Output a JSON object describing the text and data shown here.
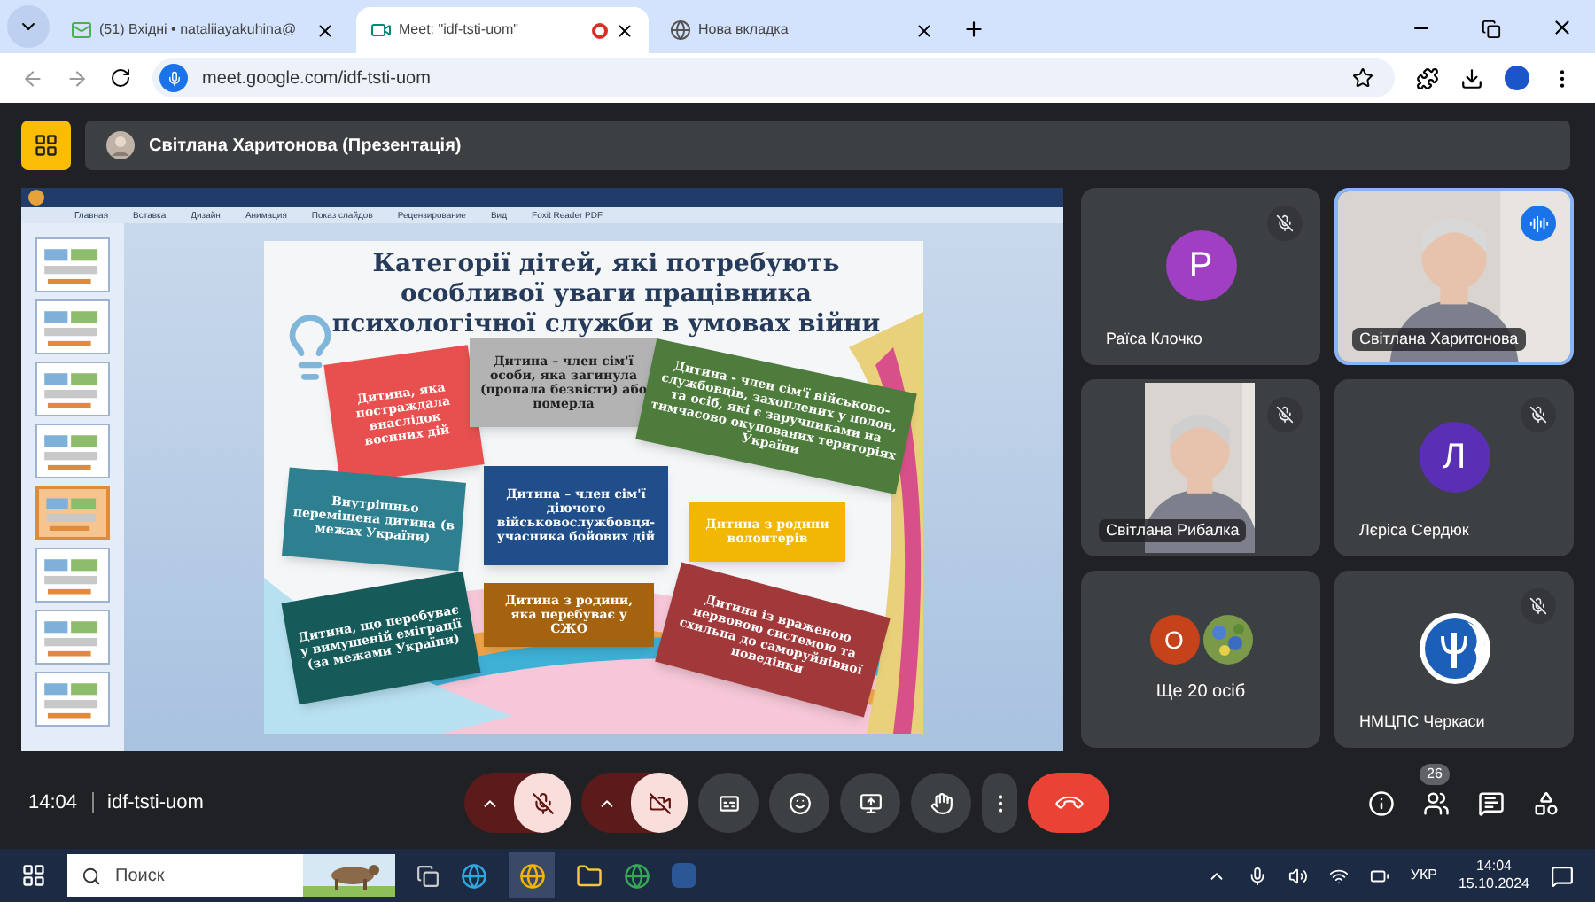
{
  "browser": {
    "tabs": [
      {
        "label": "(51) Вхідні • nataliiayakuhina@",
        "kind": "mail",
        "selected": false
      },
      {
        "label": "Meet: \"idf-tsti-uom\"",
        "kind": "meet",
        "selected": true,
        "recording": true
      },
      {
        "label": "Нова вкладка",
        "kind": "chrome",
        "selected": false
      }
    ],
    "address": "meet.google.com/idf-tsti-uom"
  },
  "meet": {
    "presenter": "Світлана Харитонова (Презентація)",
    "presentation": {
      "ribbon_tabs": [
        "Главная",
        "Вставка",
        "Дизайн",
        "Анимация",
        "Показ слайдов",
        "Рецензирование",
        "Вид",
        "Foxit Reader PDF"
      ],
      "thumbnails": [
        {
          "selected": false
        },
        {
          "selected": false
        },
        {
          "selected": false
        },
        {
          "selected": false
        },
        {
          "selected": true
        },
        {
          "selected": false
        },
        {
          "selected": false
        },
        {
          "selected": false
        }
      ],
      "slide": {
        "title": "Категорії дітей, які потребують особливої уваги працівника психологічної служби в умовах війни",
        "cards": [
          {
            "text": "Дитина, яка постраждала внаслідок воєнних дій",
            "color": "#e8504f"
          },
          {
            "text": "Дитина – член сім'ї особи, яка загинула (пропала безвісти) або померла",
            "color": "#b3b3b3"
          },
          {
            "text": "Дитина - член сім'ї військово-службовців, захоплених у полон, та осіб, які є заручниками на тимчасово окупованих територіях України",
            "color": "#4e7c3c"
          },
          {
            "text": "Внутрішньо переміщена дитина (в межах України)",
            "color": "#2e7f8f"
          },
          {
            "text": "Дитина – член сім'ї діючого військовослужбовця-учасника бойових дій",
            "color": "#1f4e8a"
          },
          {
            "text": "Дитина з родини волонтерів",
            "color": "#f2b705"
          },
          {
            "text": "Дитина, що перебуває у вимушеній еміграції (за межами України)",
            "color": "#175a5a"
          },
          {
            "text": "Дитина з родини, яка перебуває у СЖО",
            "color": "#a5620f"
          },
          {
            "text": "Дитина із враженою нервовою системою та схильна до саморуйнівної поведінки",
            "color": "#a1393a"
          }
        ]
      }
    },
    "tiles": [
      {
        "name": "Раїса Клочко",
        "kind": "avatar",
        "letter": "P",
        "color": "#a03fc4",
        "muted": true,
        "speaking": false
      },
      {
        "name": "Світлана Харитонова",
        "kind": "video",
        "muted": false,
        "speaking": true
      },
      {
        "name": "Світлана Рибалка",
        "kind": "video",
        "muted": true,
        "speaking": false
      },
      {
        "name": "Лєріса Сердюк",
        "kind": "avatar",
        "letter": "Л",
        "color": "#5b2fb5",
        "muted": true,
        "speaking": false
      },
      {
        "name": "Ще 20 осіб",
        "kind": "more",
        "letter": "О",
        "color": "#c5421a",
        "muted": false,
        "speaking": false
      },
      {
        "name": "НМЦПС Черкаси",
        "kind": "logo",
        "muted": true,
        "speaking": false
      }
    ],
    "time": "14:04",
    "code": "idf-tsti-uom",
    "mic_on": false,
    "camera_on": false,
    "people_count": "26"
  },
  "taskbar": {
    "search_placeholder": "Поиск",
    "language": "УКР",
    "time": "14:04",
    "date": "15.10.2024"
  }
}
